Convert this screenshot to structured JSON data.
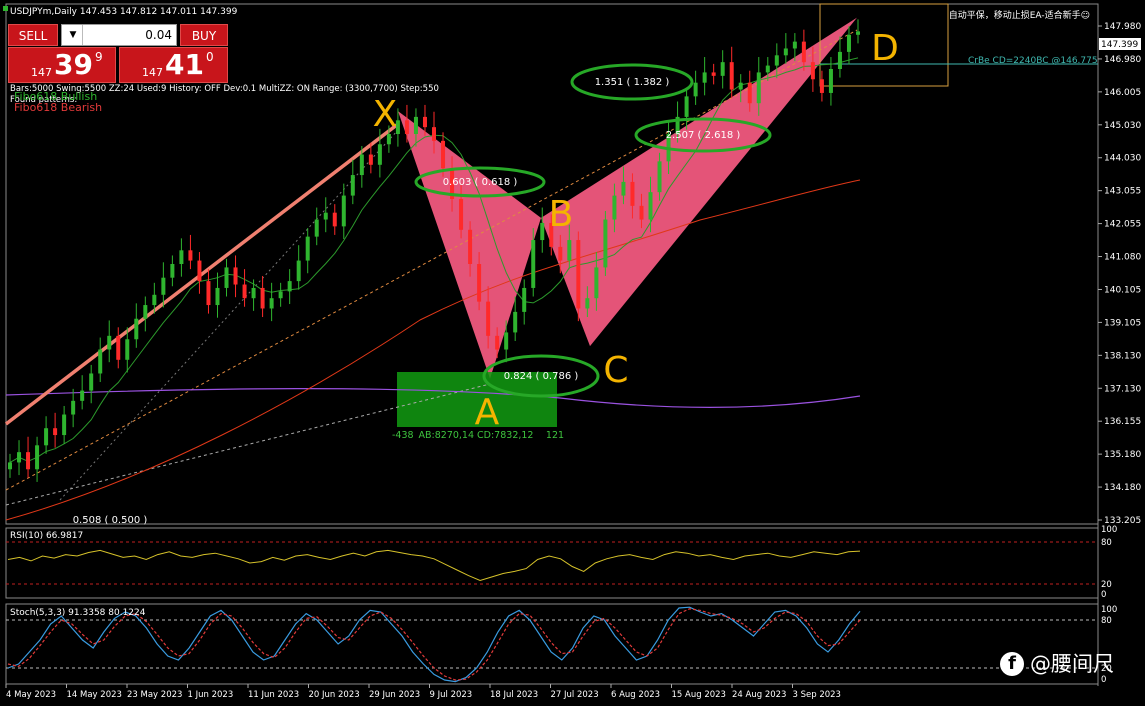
{
  "window": {
    "symbol_title": "USDJPYm,Daily  147.453 147.812 147.011 147.399",
    "info_line": "Bars:5000  Swing:5500  ZZ:24  Used:9  History: OFF Dev:0.1  MultiZZ: ON  Range: (3300,7700)  Step:550",
    "found_patterns": "Found patterns:",
    "fibo_bullish": "Fibo618 Bullish",
    "fibo_bearish": "Fibo618 Bearish",
    "top_right_note": "自动平保，移动止损EA-适合新手☺"
  },
  "trade_panel": {
    "sell_label": "SELL",
    "buy_label": "BUY",
    "lot_value": "0.04",
    "bid": {
      "prefix": "147",
      "big": "39",
      "sup": "9"
    },
    "ask": {
      "prefix": "147",
      "big": "41",
      "sup": "0"
    }
  },
  "price_tag": "147.399",
  "pattern_label": "CrBe CD=2240BC  @146.775",
  "colors": {
    "bull": "#2fb52f",
    "bear": "#ff2a2a",
    "pattern_fill": "#f0587e",
    "ellipse": "#27a827",
    "handwriting": "#f4b400",
    "rsi": "#d6c22a",
    "stoch_main": "#3a9be0",
    "stoch_signal": "#e23a3a"
  },
  "chart_data": [
    {
      "type": "candlestick",
      "y_axis": {
        "ylim": [
          133.0,
          148.2
        ],
        "ticks": [
          "147.980",
          "146.980",
          "146.005",
          "145.030",
          "144.030",
          "143.055",
          "142.055",
          "141.080",
          "140.105",
          "139.105",
          "138.130",
          "137.130",
          "136.155",
          "135.180",
          "134.180",
          "133.205"
        ]
      },
      "x_axis": {
        "ticks": [
          "4 May 2023",
          "14 May 2023",
          "23 May 2023",
          "1 Jun 2023",
          "11 Jun 2023",
          "20 Jun 2023",
          "29 Jun 2023",
          "9 Jul 2023",
          "18 Jul 2023",
          "27 Jul 2023",
          "6 Aug 2023",
          "15 Aug 2023",
          "24 Aug 2023",
          "3 Sep 2023"
        ]
      },
      "close_path": [
        134.8,
        135.1,
        134.6,
        135.3,
        135.8,
        135.6,
        136.2,
        136.6,
        136.9,
        137.4,
        138.1,
        138.5,
        137.8,
        138.4,
        139.0,
        139.4,
        139.7,
        140.2,
        140.6,
        141.0,
        140.7,
        140.1,
        139.4,
        139.9,
        140.5,
        140.0,
        139.6,
        139.9,
        139.3,
        139.6,
        139.8,
        140.1,
        140.7,
        141.4,
        141.9,
        142.1,
        141.7,
        142.6,
        143.2,
        143.8,
        143.5,
        144.1,
        144.4,
        144.8,
        144.4,
        144.9,
        144.6,
        144.2,
        143.4,
        142.5,
        141.6,
        140.6,
        139.5,
        138.5,
        138.1,
        138.6,
        139.2,
        139.9,
        141.3,
        141.8,
        141.1,
        140.7,
        141.3,
        139.3,
        139.6,
        140.5,
        141.9,
        142.6,
        143.0,
        142.3,
        141.9,
        142.7,
        143.6,
        144.4,
        144.9,
        145.5,
        145.9,
        146.2,
        146.1,
        146.5,
        145.7,
        145.9,
        145.3,
        146.2,
        146.4,
        146.7,
        146.9,
        147.1,
        146.5,
        146.0,
        145.6,
        146.3,
        146.8,
        147.3,
        147.4
      ],
      "pattern": {
        "points": {
          "X": 145.07,
          "A": 137.25,
          "B": 141.95,
          "C": 138.2,
          "D": 147.8
        },
        "ratios": [
          {
            "label": "0.603 ( 0.618 )"
          },
          {
            "label": "0.824 ( 0.786 )"
          },
          {
            "label": "2.507 ( 2.618 )"
          },
          {
            "label": "1.351 ( 1.382 )"
          },
          {
            "label": "0.508 ( 0.500 )"
          }
        ],
        "handwritten_letters": [
          "X",
          "A",
          "B",
          "C",
          "D"
        ],
        "box_text": {
          "left": "-438",
          "mid": "AB:8270,14 CD:7832,12",
          "right": "121"
        }
      }
    },
    {
      "type": "line",
      "title": "RSI(10) 66.9817",
      "ylim": [
        0,
        100
      ],
      "ticks": [
        "100",
        "80",
        "20",
        "0"
      ],
      "levels": [
        80,
        20
      ],
      "values": [
        55,
        58,
        53,
        60,
        57,
        62,
        60,
        65,
        68,
        63,
        58,
        60,
        55,
        62,
        66,
        60,
        58,
        62,
        64,
        60,
        56,
        50,
        52,
        58,
        54,
        60,
        62,
        58,
        55,
        60,
        64,
        60,
        66,
        68,
        65,
        62,
        60,
        56,
        48,
        40,
        32,
        25,
        30,
        35,
        38,
        42,
        55,
        60,
        56,
        45,
        38,
        50,
        56,
        60,
        62,
        58,
        55,
        62,
        66,
        64,
        60,
        62,
        58,
        55,
        60,
        62,
        64,
        60,
        58,
        62,
        66,
        64,
        62,
        66,
        67
      ]
    },
    {
      "type": "line",
      "title": "Stoch(5,3,3) 91.3358 80.1224",
      "ylim": [
        0,
        100
      ],
      "ticks": [
        "100",
        "80",
        "20",
        "0"
      ],
      "levels": [
        80,
        20
      ],
      "series": [
        {
          "values": [
            20,
            25,
            40,
            55,
            75,
            85,
            70,
            55,
            45,
            65,
            82,
            90,
            85,
            70,
            50,
            35,
            30,
            45,
            65,
            85,
            92,
            80,
            60,
            40,
            30,
            35,
            55,
            75,
            88,
            80,
            65,
            50,
            60,
            80,
            92,
            90,
            75,
            60,
            40,
            25,
            12,
            5,
            3,
            8,
            20,
            40,
            65,
            85,
            92,
            80,
            60,
            40,
            30,
            45,
            70,
            85,
            80,
            60,
            45,
            30,
            35,
            55,
            80,
            95,
            96,
            90,
            85,
            88,
            80,
            70,
            60,
            75,
            90,
            92,
            85,
            70,
            50,
            40,
            55,
            75,
            91
          ]
        },
        {
          "values": [
            25,
            22,
            32,
            48,
            65,
            80,
            75,
            62,
            50,
            55,
            72,
            85,
            88,
            78,
            62,
            45,
            35,
            38,
            55,
            75,
            88,
            85,
            70,
            52,
            38,
            33,
            45,
            65,
            82,
            84,
            72,
            58,
            55,
            70,
            85,
            90,
            82,
            68,
            52,
            35,
            20,
            10,
            5,
            6,
            15,
            30,
            52,
            75,
            88,
            86,
            70,
            52,
            38,
            40,
            60,
            78,
            82,
            70,
            55,
            40,
            35,
            45,
            68,
            88,
            94,
            92,
            88,
            86,
            82,
            75,
            65,
            70,
            82,
            90,
            88,
            78,
            60,
            48,
            50,
            65,
            80
          ]
        }
      ]
    }
  ]
}
